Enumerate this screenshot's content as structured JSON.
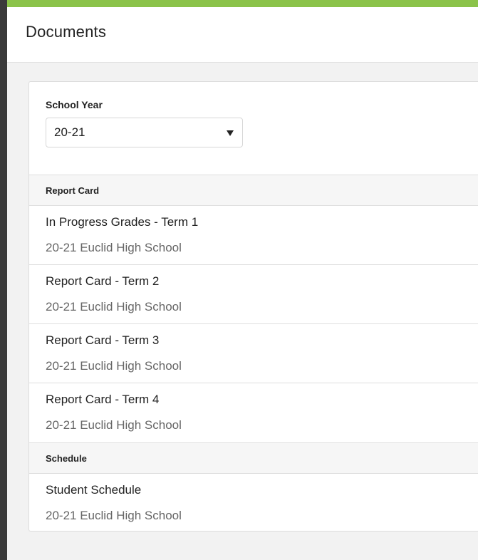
{
  "header": {
    "title": "Documents"
  },
  "filter": {
    "label": "School Year",
    "selected": "20-21"
  },
  "sections": [
    {
      "label": "Report Card",
      "items": [
        {
          "title": "In Progress Grades - Term 1",
          "subtitle": "20-21 Euclid High School"
        },
        {
          "title": "Report Card - Term 2",
          "subtitle": "20-21 Euclid High School"
        },
        {
          "title": "Report Card - Term 3",
          "subtitle": "20-21 Euclid High School"
        },
        {
          "title": "Report Card - Term 4",
          "subtitle": "20-21 Euclid High School"
        }
      ]
    },
    {
      "label": "Schedule",
      "items": [
        {
          "title": "Student Schedule",
          "subtitle": "20-21 Euclid High School"
        }
      ]
    }
  ],
  "colors": {
    "accent": "#8bc34a",
    "rail": "#3a3a3a"
  }
}
